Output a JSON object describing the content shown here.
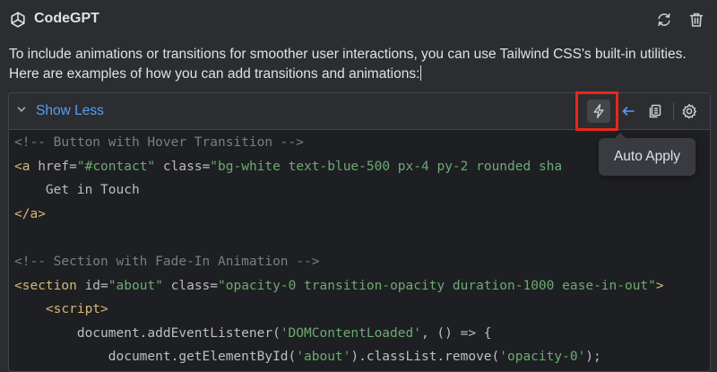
{
  "header": {
    "app_title": "CodeGPT",
    "logo_icon": "openai-logo-icon",
    "refresh_icon": "refresh-icon",
    "trash_icon": "trash-icon"
  },
  "message": {
    "text": "To include animations or transitions for smoother user interactions, you can use Tailwind CSS's built-in utilities. Here are examples of how you can add transitions and animations:"
  },
  "code_block": {
    "toggle_label": "Show Less",
    "toggle_icon": "chevron-down-icon",
    "tools": [
      "lightning-bolt-icon",
      "arrow-left-icon",
      "copy-icon",
      "gear-icon"
    ],
    "tooltip": "Auto Apply",
    "highlight_color": "#e8271a",
    "lines": [
      [
        {
          "t": "<!-- Button with Hover Transition -->",
          "c": "comment"
        }
      ],
      [
        {
          "t": "<a ",
          "c": "tag"
        },
        {
          "t": "href",
          "c": "attr"
        },
        {
          "t": "=",
          "c": "text"
        },
        {
          "t": "\"#contact\"",
          "c": "str"
        },
        {
          "t": " ",
          "c": "text"
        },
        {
          "t": "class",
          "c": "attr"
        },
        {
          "t": "=",
          "c": "text"
        },
        {
          "t": "\"bg-white text-blue-500 px-4 py-2 rounded sha",
          "c": "str"
        }
      ],
      [
        {
          "t": "    Get in Touch",
          "c": "text"
        }
      ],
      [
        {
          "t": "</a>",
          "c": "tag"
        }
      ],
      [
        {
          "t": "",
          "c": "text"
        }
      ],
      [
        {
          "t": "<!-- Section with Fade-In Animation -->",
          "c": "comment"
        }
      ],
      [
        {
          "t": "<section ",
          "c": "tag"
        },
        {
          "t": "id",
          "c": "attr"
        },
        {
          "t": "=",
          "c": "text"
        },
        {
          "t": "\"about\"",
          "c": "str"
        },
        {
          "t": " ",
          "c": "text"
        },
        {
          "t": "class",
          "c": "attr"
        },
        {
          "t": "=",
          "c": "text"
        },
        {
          "t": "\"opacity-0 transition-opacity duration-1000 ease-in-out\"",
          "c": "str"
        },
        {
          "t": ">",
          "c": "tag"
        }
      ],
      [
        {
          "t": "    ",
          "c": "text"
        },
        {
          "t": "<script>",
          "c": "tag"
        }
      ],
      [
        {
          "t": "        document.addEventListener(",
          "c": "text"
        },
        {
          "t": "'DOMContentLoaded'",
          "c": "str"
        },
        {
          "t": ", () => {",
          "c": "text"
        }
      ],
      [
        {
          "t": "            document.getElementById(",
          "c": "text"
        },
        {
          "t": "'about'",
          "c": "str"
        },
        {
          "t": ").classList.remove(",
          "c": "text"
        },
        {
          "t": "'opacity-0'",
          "c": "str"
        },
        {
          "t": ");",
          "c": "text"
        }
      ]
    ]
  }
}
